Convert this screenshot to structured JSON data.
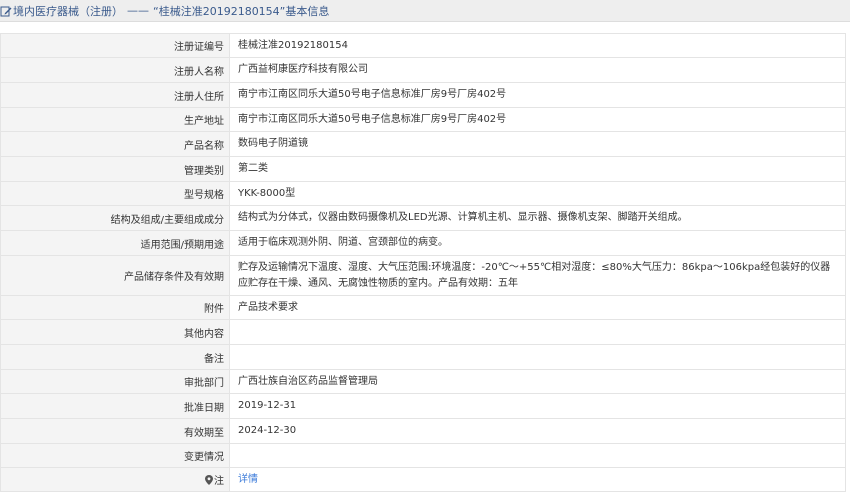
{
  "header": {
    "category": "境内医疗器械（注册）",
    "separator": "——",
    "title": "“桂械注准20192180154”基本信息"
  },
  "rows": [
    {
      "label": "注册证编号",
      "value": "桂械注准20192180154"
    },
    {
      "label": "注册人名称",
      "value": "广西益柯康医疗科技有限公司"
    },
    {
      "label": "注册人住所",
      "value": "南宁市江南区同乐大道50号电子信息标准厂房9号厂房402号"
    },
    {
      "label": "生产地址",
      "value": "南宁市江南区同乐大道50号电子信息标准厂房9号厂房402号"
    },
    {
      "label": "产品名称",
      "value": "数码电子阴道镜"
    },
    {
      "label": "管理类别",
      "value": "第二类"
    },
    {
      "label": "型号规格",
      "value": "YKK-8000型"
    },
    {
      "label": "结构及组成/主要组成成分",
      "value": "结构式为分体式，仪器由数码摄像机及LED光源、计算机主机、显示器、摄像机支架、脚踏开关组成。"
    },
    {
      "label": "适用范围/预期用途",
      "value": "适用于临床观测外阴、阴道、宫颈部位的病变。"
    },
    {
      "label": "产品储存条件及有效期",
      "value": "贮存及运输情况下温度、湿度、大气压范围:环境温度：-20℃～+55℃相对湿度：≤80%大气压力：86kpa～106kpa经包装好的仪器应贮存在干燥、通风、无腐蚀性物质的室内。产品有效期：五年"
    },
    {
      "label": "附件",
      "value": "产品技术要求"
    },
    {
      "label": "其他内容",
      "value": ""
    },
    {
      "label": "备注",
      "value": ""
    },
    {
      "label": "审批部门",
      "value": "广西壮族自治区药品监督管理局"
    },
    {
      "label": "批准日期",
      "value": "2019-12-31"
    },
    {
      "label": "有效期至",
      "value": "2024-12-30"
    },
    {
      "label": "变更情况",
      "value": ""
    }
  ],
  "note": {
    "label": "注",
    "link": "详情"
  },
  "colors": {
    "header_text": "#3a5a8c",
    "link": "#3a7ad9",
    "label_bg": "#f4f4f4",
    "header_bg": "#eeeeee"
  }
}
